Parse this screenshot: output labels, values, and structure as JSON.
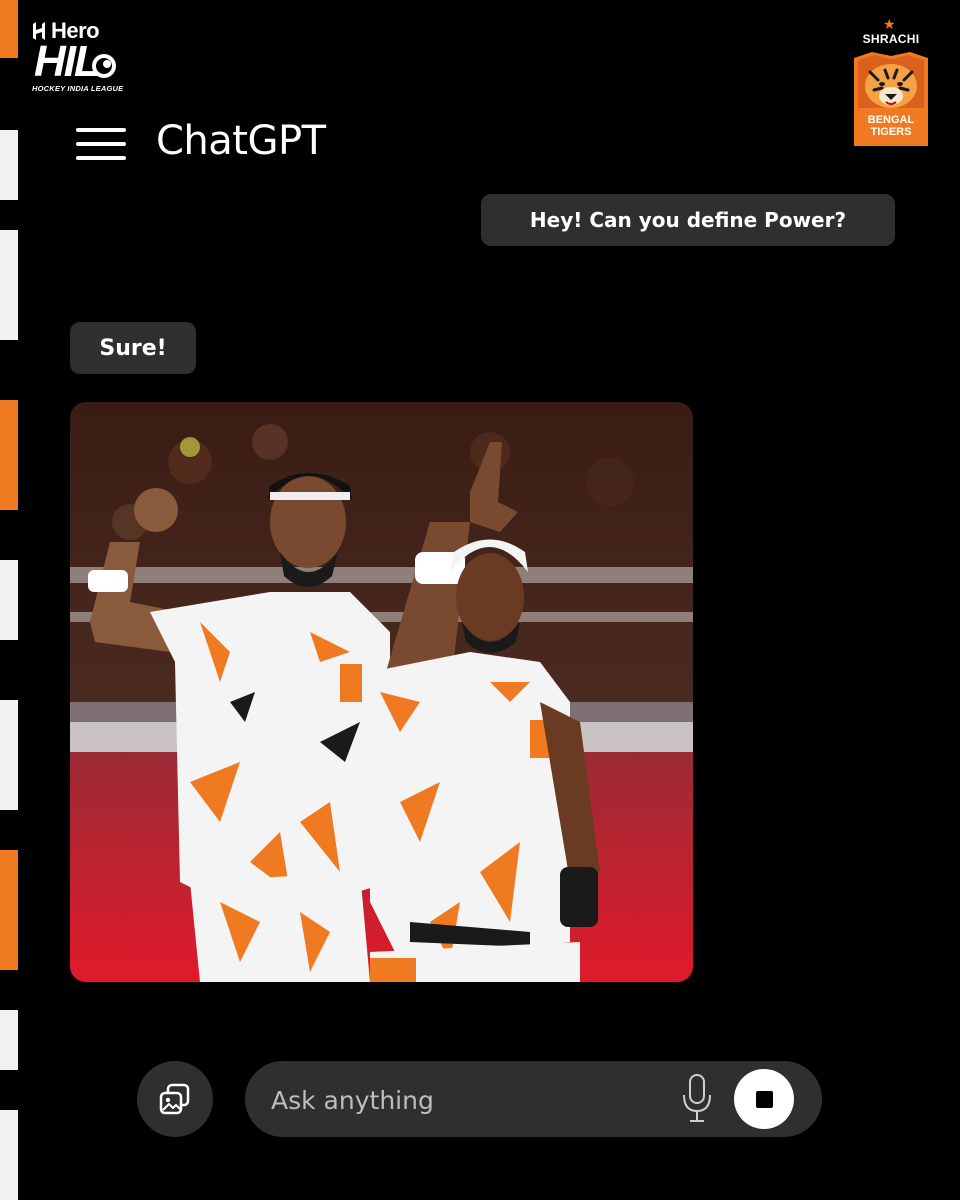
{
  "branding": {
    "league_sponsor": "Hero",
    "league_logo_text": "HIL",
    "league_name": "HOCKEY INDIA LEAGUE",
    "team_sponsor": "SHRACHI",
    "team_name_line1": "BENGAL",
    "team_name_line2": "TIGERS"
  },
  "header": {
    "menu_icon": "hamburger-menu-icon",
    "title": "ChatGPT"
  },
  "conversation": {
    "user_message": "Hey! Can you define Power?",
    "assistant_message": "Sure!",
    "image_description_icon": "photo"
  },
  "composer": {
    "attach_icon": "image-attach-icon",
    "placeholder": "Ask anything",
    "mic_icon": "microphone-icon",
    "stop_icon": "stop-icon"
  },
  "colors": {
    "background": "#000000",
    "bubble": "#2f2f2f",
    "accent_orange": "#f07a22",
    "text": "#ffffff"
  }
}
